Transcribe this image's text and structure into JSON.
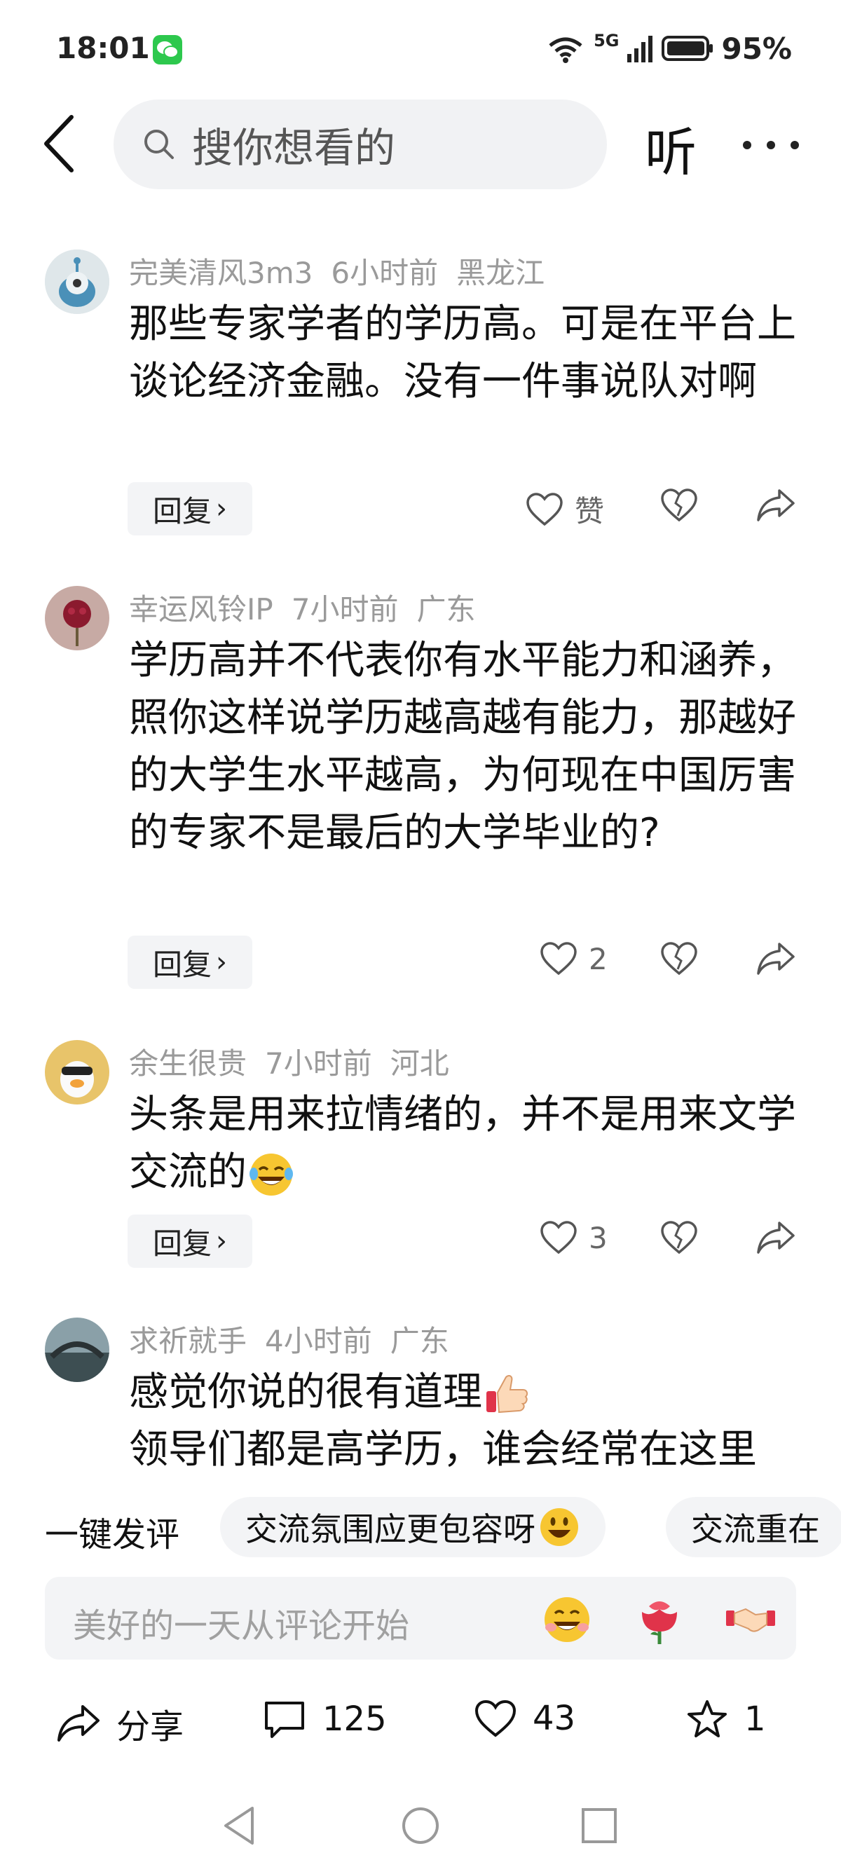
{
  "status_bar": {
    "time": "18:01",
    "battery": "95%",
    "network": "5G"
  },
  "header": {
    "search_placeholder": "搜你想看的",
    "listen_label": "听"
  },
  "comments": [
    {
      "user": "完美清风3m3",
      "time": "6小时前",
      "location": "黑龙江",
      "text": "那些专家学者的学历高。可是在平台上谈论经济金融。没有一件事说队对啊",
      "reply_label": "回复",
      "like_label": "赞"
    },
    {
      "user": "幸运风铃IP",
      "time": "7小时前",
      "location": "广东",
      "text": "学历高并不代表你有水平能力和涵养，照你这样说学历越高越有能力，那越好的大学生水平越高，为何现在中国厉害的专家不是最后的大学毕业的?",
      "reply_label": "回复",
      "like_label": "2"
    },
    {
      "user": "余生很贵",
      "time": "7小时前",
      "location": "河北",
      "text": "头条是用来拉情绪的，并不是用来文学交流的",
      "reply_label": "回复",
      "like_label": "3"
    },
    {
      "user": "求祈就手",
      "time": "4小时前",
      "location": "广东",
      "text_line1": "感觉你说的很有道理",
      "text_line2": "领导们都是高学历，谁会经常在这里"
    }
  ],
  "quick_comment": {
    "label": "一键发评",
    "chips": [
      "交流氛围应更包容呀",
      "交流重在"
    ]
  },
  "input": {
    "placeholder": "美好的一天从评论开始"
  },
  "bottom_bar": {
    "share_label": "分享",
    "comment_count": "125",
    "like_count": "43",
    "favorite_count": "1"
  },
  "colors": {
    "meta_gray": "#9a9a9a",
    "chip_bg": "#f3f4f6",
    "wechat_green": "#2dc84d"
  }
}
